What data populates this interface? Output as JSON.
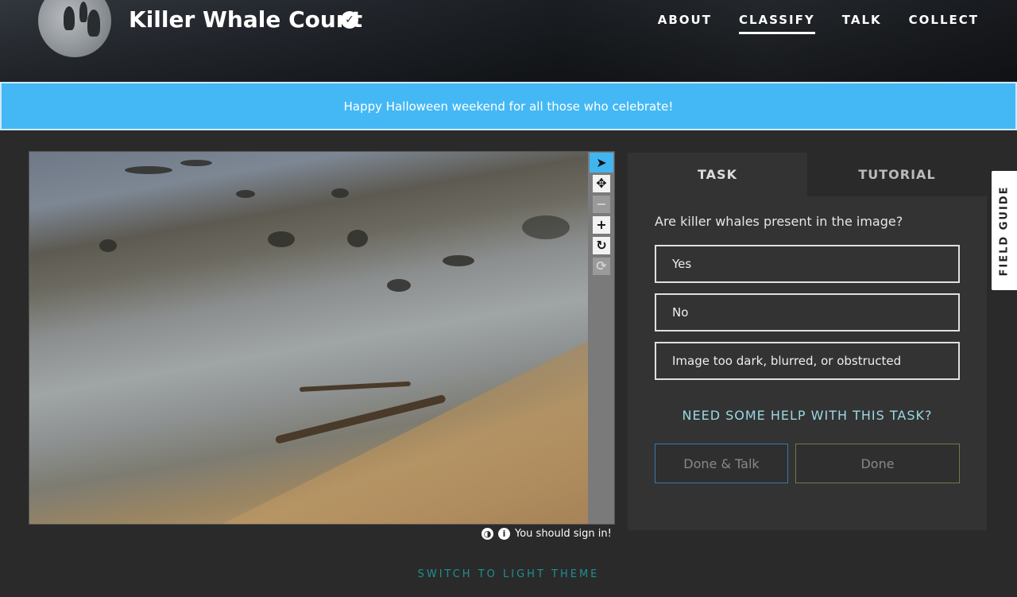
{
  "header": {
    "project_title": "Killer Whale Count",
    "nav": [
      {
        "label": "ABOUT"
      },
      {
        "label": "CLASSIFY"
      },
      {
        "label": "TALK"
      },
      {
        "label": "COLLECT"
      }
    ]
  },
  "banner": {
    "text": "Happy Halloween weekend for all those who celebrate!"
  },
  "viewer": {
    "sign_in_note": "You should sign in!"
  },
  "task": {
    "tabs": [
      {
        "label": "TASK"
      },
      {
        "label": "TUTORIAL"
      }
    ],
    "question": "Are killer whales present in the image?",
    "answers": [
      {
        "label": "Yes"
      },
      {
        "label": "No"
      },
      {
        "label": "Image too dark, blurred, or obstructed"
      }
    ],
    "help_link": "NEED SOME HELP WITH THIS TASK?",
    "done_talk_label": "Done & Talk",
    "done_label": "Done"
  },
  "field_guide_label": "FIELD GUIDE",
  "theme_switch_label": "SWITCH TO LIGHT THEME",
  "colors": {
    "banner": "#44b8f5",
    "help_link": "#9ad8e2",
    "theme_switch": "#1e8f94"
  }
}
